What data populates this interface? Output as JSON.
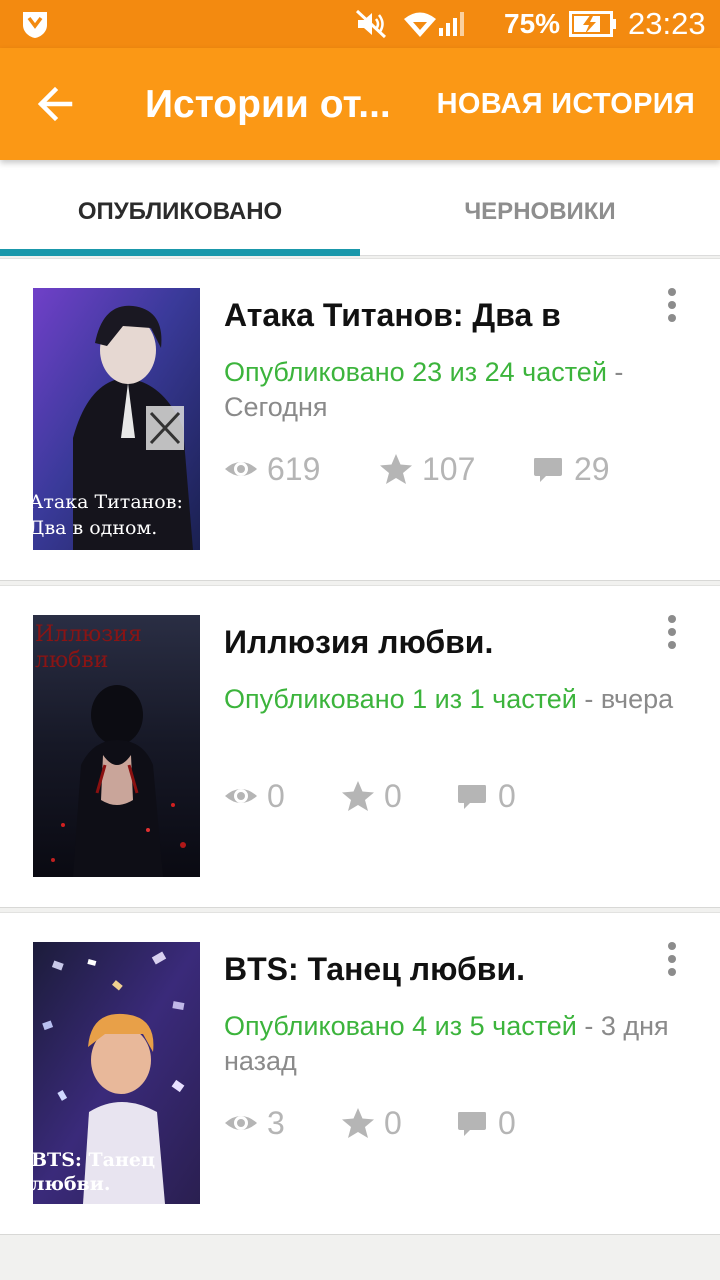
{
  "status_bar": {
    "battery_percent": "75%",
    "time": "23:23"
  },
  "app_bar": {
    "title": "Истории от...",
    "new_story_label": "НОВАЯ ИСТОРИЯ"
  },
  "tabs": [
    {
      "label": "ОПУБЛИКОВАНО",
      "active": true
    },
    {
      "label": "ЧЕРНОВИКИ",
      "active": false
    }
  ],
  "colors": {
    "status_bar": "#f38a10",
    "app_bar": "#fb9815",
    "tab_indicator": "#1a98ab",
    "published_green": "#3cb43c"
  },
  "stories": [
    {
      "title": "Атака Титанов: Два в",
      "published": "Опубликовано 23 из 24 частей",
      "separator": " - ",
      "date": "Сегодня",
      "views": "619",
      "votes": "107",
      "comments": "29",
      "cover_text_line1": "Атака Титанов:",
      "cover_text_line2": "Два в одном."
    },
    {
      "title": "Иллюзия любви.",
      "published": "Опубликовано 1 из 1 частей",
      "separator": " - ",
      "date": "вчера",
      "views": "0",
      "votes": "0",
      "comments": "0",
      "cover_text_line1": "Иллюзия",
      "cover_text_line2": "любви"
    },
    {
      "title": "BTS: Танец любви.",
      "published": "Опубликовано 4 из 5 частей",
      "separator": " - ",
      "date": "3 дня назад",
      "views": "3",
      "votes": "0",
      "comments": "0",
      "cover_text_line1": "BTS: Танец",
      "cover_text_line2": "любви."
    }
  ]
}
